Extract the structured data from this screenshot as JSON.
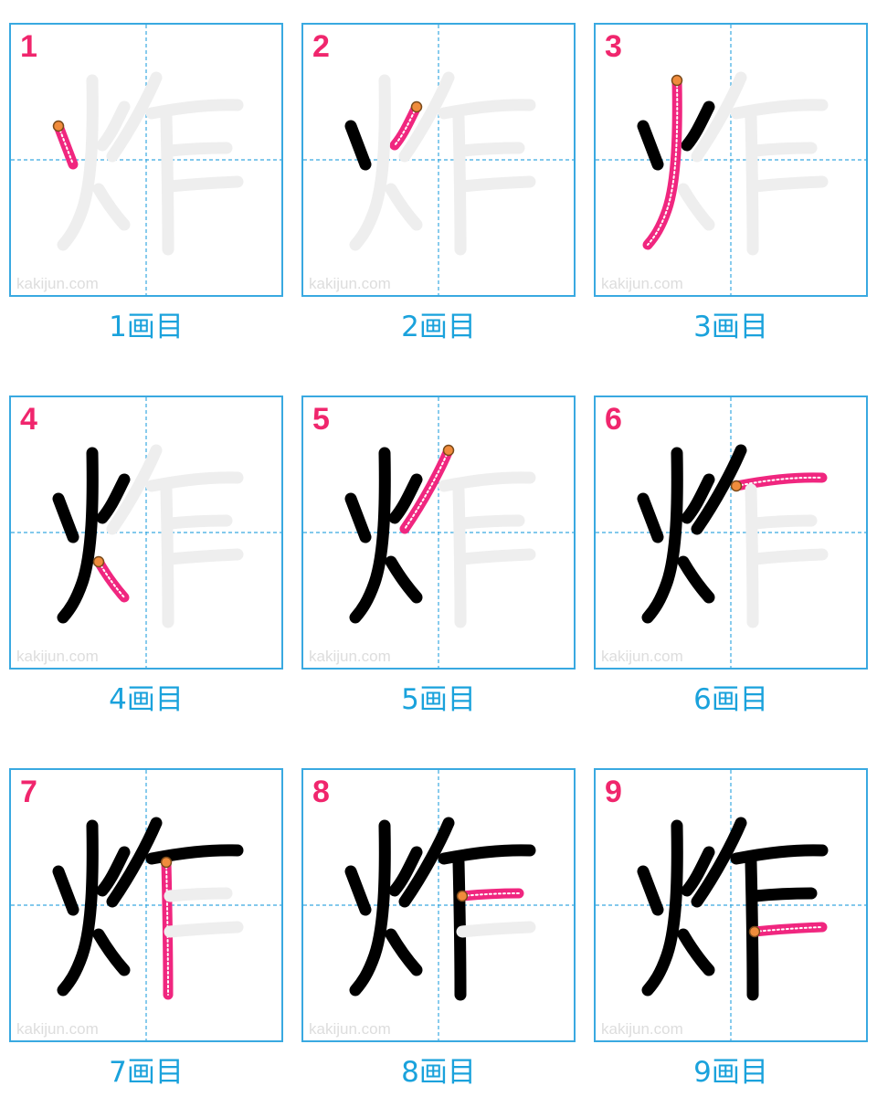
{
  "watermark": "kakijun.com",
  "colors": {
    "border": "#39a9e1",
    "guide": "#39a9e1",
    "step_number": "#f0266d",
    "caption": "#1aa2dc",
    "done_stroke": "#000000",
    "current_stroke": "#f0267f",
    "ghost": "#eeeeee",
    "start_dot": "#f08c3c"
  },
  "panels": [
    {
      "number": "1",
      "caption": "1画目"
    },
    {
      "number": "2",
      "caption": "2画目"
    },
    {
      "number": "3",
      "caption": "3画目"
    },
    {
      "number": "4",
      "caption": "4画目"
    },
    {
      "number": "5",
      "caption": "5画目"
    },
    {
      "number": "6",
      "caption": "6画目"
    },
    {
      "number": "7",
      "caption": "7画目"
    },
    {
      "number": "8",
      "caption": "8画目"
    },
    {
      "number": "9",
      "caption": "9画目"
    }
  ]
}
